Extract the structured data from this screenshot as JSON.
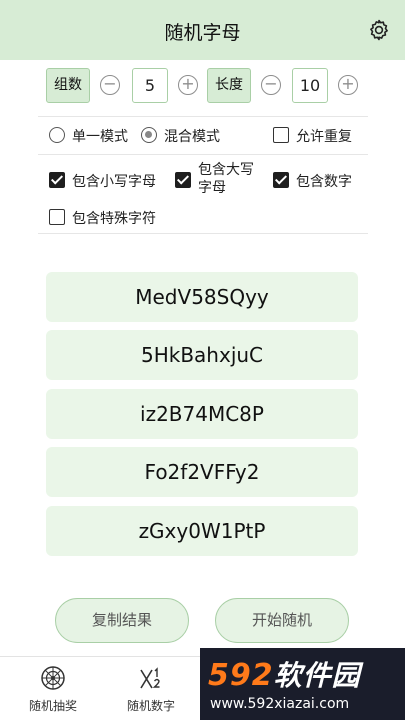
{
  "header": {
    "title": "随机字母",
    "settings_icon": "gear-icon"
  },
  "controls": {
    "group_label": "组数",
    "group_value": "5",
    "length_label": "长度",
    "length_value": "10",
    "minus_symbol": "−",
    "plus_symbol": "+"
  },
  "modes": {
    "single": "单一模式",
    "mixed": "混合模式",
    "allow_repeat": "允许重复",
    "selected": "mixed"
  },
  "options": {
    "lowercase": "包含小写字母",
    "uppercase_line1": "包含大写",
    "uppercase_line2": "字母",
    "digits": "包含数字",
    "special": "包含特殊字符"
  },
  "results": [
    "MedV58SQyy",
    "5HkBahxjuC",
    "iz2B74MC8P",
    "Fo2f2VFFy2",
    "zGxy0W1PtP"
  ],
  "actions": {
    "copy": "复制结果",
    "start": "开始随机"
  },
  "tabbar": {
    "tabs": [
      {
        "label": "随机抽奖",
        "icon": "wheel-icon"
      },
      {
        "label": "随机数字",
        "icon": "dice-numbers-icon"
      }
    ]
  },
  "watermark": {
    "brand_number": "592",
    "brand_text": "软件园",
    "url": "www.592xiazai.com"
  },
  "colors": {
    "accent_bg": "#d7ecd5",
    "accent_border": "#a9cfa6",
    "result_bg": "#eaf6e8"
  }
}
